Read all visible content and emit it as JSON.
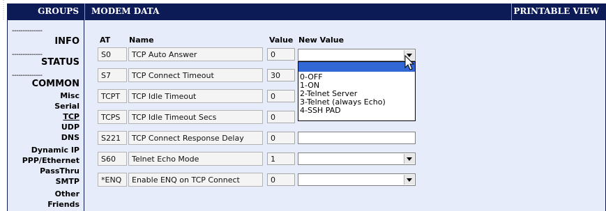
{
  "header": {
    "groups": "GROUPS",
    "section": "MODEM DATA",
    "printable": "PRINTABLE VIEW"
  },
  "sidebar": {
    "dash": "--------------",
    "info": "INFO",
    "status": "STATUS",
    "common": "COMMON",
    "links": [
      "Misc",
      "Serial",
      "TCP",
      "UDP",
      "DNS",
      "Dynamic IP",
      "PPP/Ethernet",
      "PassThru",
      "SMTP",
      "Other",
      "Friends"
    ]
  },
  "columns": {
    "at": "AT",
    "name": "Name",
    "value": "Value",
    "new_value": "New Value"
  },
  "rows": [
    {
      "at": "S0",
      "name": "TCP Auto Answer",
      "value": "0"
    },
    {
      "at": "S7",
      "name": "TCP Connect Timeout",
      "value": "30"
    },
    {
      "at": "TCPT",
      "name": "TCP Idle Timeout",
      "value": "0"
    },
    {
      "at": "TCPS",
      "name": "TCP Idle Timeout Secs",
      "value": "0"
    },
    {
      "at": "S221",
      "name": "TCP Connect Response Delay",
      "value": "0"
    },
    {
      "at": "S60",
      "name": "Telnet Echo Mode",
      "value": "1"
    },
    {
      "at": "*ENQ",
      "name": "Enable ENQ on TCP Connect",
      "value": "0"
    }
  ],
  "dropdown_options": [
    "0-OFF",
    "1-ON",
    "2-Telnet Server",
    "3-Telnet (always Echo)",
    "4-SSH PAD"
  ],
  "colors": {
    "header_bg": "#0c1a55",
    "panel_bg": "#e6ecfa",
    "highlight": "#3168d6"
  }
}
